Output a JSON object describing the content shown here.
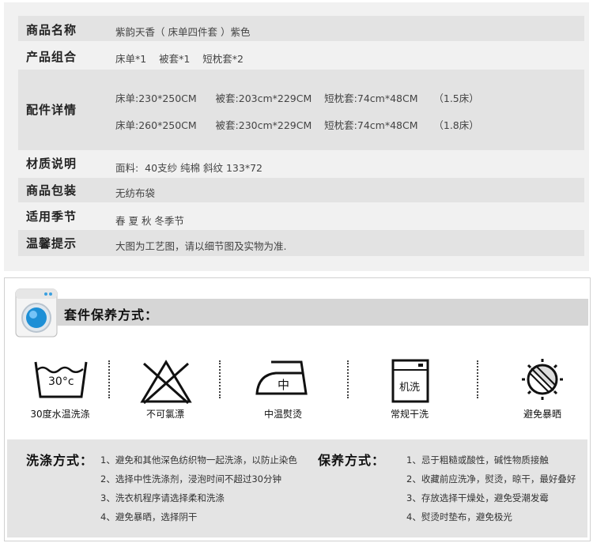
{
  "spec": {
    "rows": [
      {
        "key": "商品名称",
        "values": [
          "紫韵天香（ 床单四件套 ）紫色"
        ]
      },
      {
        "key": "产品组合",
        "values": [
          "床单*1    被套*1    短枕套*2"
        ]
      },
      {
        "key": "配件详情",
        "values": [
          "床单:230*250CM      被套:203cm*229CM    短枕套:74cm*48CM     （1.5床）",
          "床单:260*250CM      被套:230cm*229CM    短枕套:74cm*48CM     （1.8床）"
        ]
      },
      {
        "key": "材质说明",
        "values": [
          "面料:  40支纱 纯棉 斜纹 133*72"
        ]
      },
      {
        "key": "商品包装",
        "values": [
          "无纺布袋"
        ]
      },
      {
        "key": "适用季节",
        "values": [
          "春 夏 秋 冬季节"
        ]
      },
      {
        "key": "温馨提示",
        "values": [
          "大图为工艺图，请以细节图及实物为准."
        ]
      }
    ]
  },
  "care": {
    "title": "套件保养方式：",
    "symbols": [
      {
        "icon": "wash-30-icon",
        "text": "30°c",
        "label": "30度水温洗涤"
      },
      {
        "icon": "no-bleach-icon",
        "label": "不可氯漂"
      },
      {
        "icon": "iron-medium-icon",
        "text": "中",
        "label": "中温熨烫"
      },
      {
        "icon": "machine-wash-icon",
        "text": "机洗",
        "label": "常规干洗"
      },
      {
        "icon": "avoid-sun-icon",
        "label": "避免暴晒"
      }
    ],
    "wash": {
      "heading": "洗涤方式：",
      "items": [
        "1、避免和其他深色纺织物一起洗涤，以防止染色",
        "2、选择中性洗涤剂，浸泡时间不超过30分钟",
        "3、洗衣机程序请选择柔和洗涤",
        "4、避免暴晒，选择阴干"
      ]
    },
    "maintain": {
      "heading": "保养方式：",
      "items": [
        "1、忌于粗糙或酸性，碱性物质接触",
        "2、收藏前应洗净，熨烫，晾干，最好叠好",
        "3、存放选择干燥处，避免受潮发霉",
        "4、熨烫时垫布，避免极光"
      ]
    }
  },
  "colors": {
    "bg_panel": "#f1f1f1",
    "row_bg": "#e3e3e3",
    "accent_blue": "#1d8fd6"
  }
}
